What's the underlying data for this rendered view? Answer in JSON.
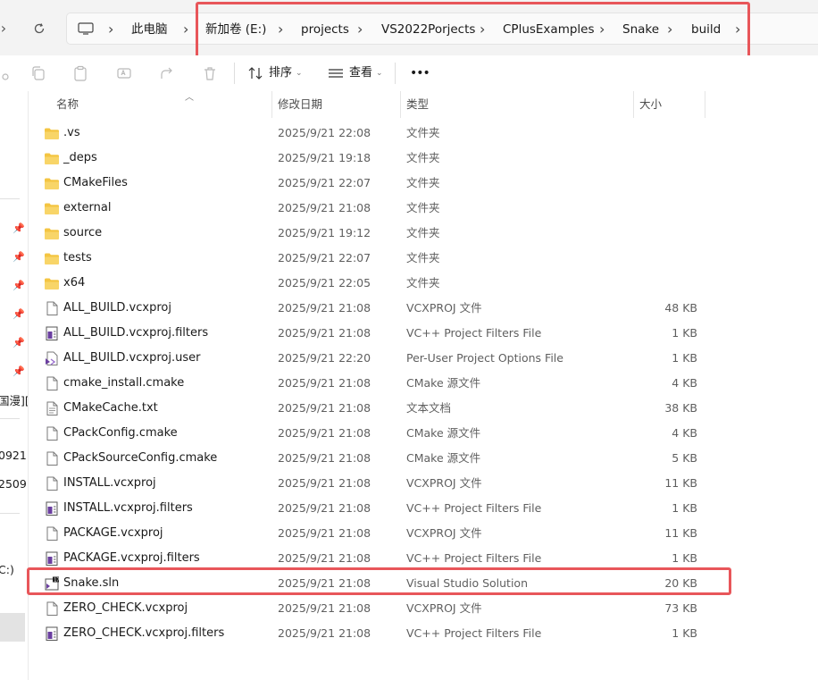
{
  "address": {
    "crumbs": [
      "此电脑",
      "新加卷 (E:)",
      "projects",
      "VS2022Porjects",
      "CPlusExamples",
      "Snake",
      "build"
    ]
  },
  "toolbar": {
    "sort_label": "排序",
    "view_label": "查看",
    "more_label": "•••"
  },
  "columns": {
    "name": "名称",
    "date": "修改日期",
    "type": "类型",
    "size": "大小"
  },
  "sidebar": {
    "partial_items": [
      "国漫][",
      "0921",
      "2509",
      "C:)"
    ]
  },
  "files": [
    {
      "name": ".vs",
      "date": "2025/9/21 22:08",
      "type": "文件夹",
      "size": "",
      "icon": "folder-icon"
    },
    {
      "name": "_deps",
      "date": "2025/9/21 19:18",
      "type": "文件夹",
      "size": "",
      "icon": "folder-icon"
    },
    {
      "name": "CMakeFiles",
      "date": "2025/9/21 22:07",
      "type": "文件夹",
      "size": "",
      "icon": "folder-icon"
    },
    {
      "name": "external",
      "date": "2025/9/21 21:08",
      "type": "文件夹",
      "size": "",
      "icon": "folder-icon"
    },
    {
      "name": "source",
      "date": "2025/9/21 19:12",
      "type": "文件夹",
      "size": "",
      "icon": "folder-icon"
    },
    {
      "name": "tests",
      "date": "2025/9/21 22:07",
      "type": "文件夹",
      "size": "",
      "icon": "folder-icon"
    },
    {
      "name": "x64",
      "date": "2025/9/21 22:05",
      "type": "文件夹",
      "size": "",
      "icon": "folder-icon"
    },
    {
      "name": "ALL_BUILD.vcxproj",
      "date": "2025/9/21 21:08",
      "type": "VCXPROJ 文件",
      "size": "48 KB",
      "icon": "document-icon"
    },
    {
      "name": "ALL_BUILD.vcxproj.filters",
      "date": "2025/9/21 21:08",
      "type": "VC++ Project Filters File",
      "size": "1 KB",
      "icon": "filters-file-icon"
    },
    {
      "name": "ALL_BUILD.vcxproj.user",
      "date": "2025/9/21 22:20",
      "type": "Per-User Project Options File",
      "size": "1 KB",
      "icon": "vs-user-file-icon"
    },
    {
      "name": "cmake_install.cmake",
      "date": "2025/9/21 21:08",
      "type": "CMake 源文件",
      "size": "4 KB",
      "icon": "document-icon"
    },
    {
      "name": "CMakeCache.txt",
      "date": "2025/9/21 21:08",
      "type": "文本文档",
      "size": "38 KB",
      "icon": "text-file-icon"
    },
    {
      "name": "CPackConfig.cmake",
      "date": "2025/9/21 21:08",
      "type": "CMake 源文件",
      "size": "4 KB",
      "icon": "document-icon"
    },
    {
      "name": "CPackSourceConfig.cmake",
      "date": "2025/9/21 21:08",
      "type": "CMake 源文件",
      "size": "5 KB",
      "icon": "document-icon"
    },
    {
      "name": "INSTALL.vcxproj",
      "date": "2025/9/21 21:08",
      "type": "VCXPROJ 文件",
      "size": "11 KB",
      "icon": "document-icon"
    },
    {
      "name": "INSTALL.vcxproj.filters",
      "date": "2025/9/21 21:08",
      "type": "VC++ Project Filters File",
      "size": "1 KB",
      "icon": "filters-file-icon"
    },
    {
      "name": "PACKAGE.vcxproj",
      "date": "2025/9/21 21:08",
      "type": "VCXPROJ 文件",
      "size": "11 KB",
      "icon": "document-icon"
    },
    {
      "name": "PACKAGE.vcxproj.filters",
      "date": "2025/9/21 21:08",
      "type": "VC++ Project Filters File",
      "size": "1 KB",
      "icon": "filters-file-icon"
    },
    {
      "name": "Snake.sln",
      "date": "2025/9/21 21:08",
      "type": "Visual Studio Solution",
      "size": "20 KB",
      "icon": "vs-solution-icon"
    },
    {
      "name": "ZERO_CHECK.vcxproj",
      "date": "2025/9/21 21:08",
      "type": "VCXPROJ 文件",
      "size": "73 KB",
      "icon": "document-icon"
    },
    {
      "name": "ZERO_CHECK.vcxproj.filters",
      "date": "2025/9/21 21:08",
      "type": "VC++ Project Filters File",
      "size": "1 KB",
      "icon": "filters-file-icon"
    }
  ],
  "colors": {
    "highlight": "#e8565a",
    "folder": "#f4c542",
    "filters_icon": "#6b3fa0"
  }
}
